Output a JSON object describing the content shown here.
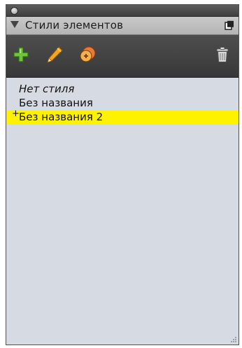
{
  "panel": {
    "title": "Стили элементов"
  },
  "toolbar": {
    "new_icon": "plus-icon",
    "edit_icon": "pencil-icon",
    "duplicate_icon": "duplicate-icon",
    "delete_icon": "trash-icon"
  },
  "styles": {
    "items": [
      {
        "label": "Нет стиля",
        "italic": true,
        "selected": false
      },
      {
        "label": "Без названия",
        "italic": false,
        "selected": false
      },
      {
        "label": "Без названия 2",
        "italic": false,
        "selected": true,
        "marker": "+"
      }
    ]
  },
  "colors": {
    "selection": "#fff200",
    "list_background": "#d6dbe3",
    "toolbar_background": "#444444"
  }
}
